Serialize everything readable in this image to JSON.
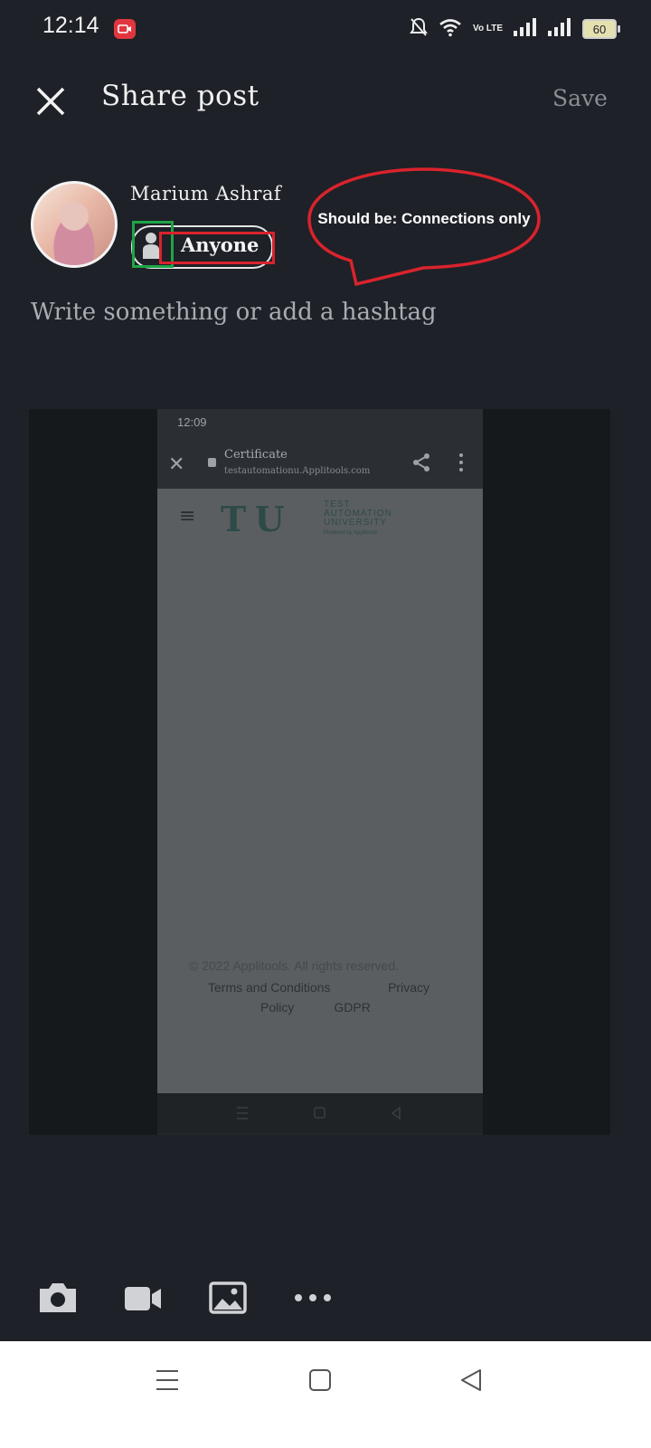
{
  "status_bar": {
    "time": "12:14",
    "volte_label": "Vo LTE",
    "battery_level": "60"
  },
  "header": {
    "title": "Share post",
    "save_label": "Save"
  },
  "profile": {
    "name": "Marium Ashraf",
    "audience_label": "Anyone"
  },
  "annotation": {
    "callout_text": "Should be: Connections only",
    "colors": {
      "red": "#d9232d",
      "green": "#1ea548"
    }
  },
  "composer": {
    "placeholder": "Write something or add a hashtag"
  },
  "embedded_screenshot": {
    "time": "12:09",
    "page_title": "Certificate",
    "url": "testautomationu.Applitools.com",
    "logo_mark": "T U",
    "logo_lines": [
      "TEST",
      "AUTOMATION",
      "UNIVERSITY"
    ],
    "logo_powered": "Powered by Applitools",
    "footer_copy": "© 2022 Applitools. All rights reserved.",
    "footer_links": [
      "Terms and Conditions",
      "Privacy",
      "Policy",
      "GDPR"
    ]
  },
  "toolbar": {
    "icons": [
      "camera-icon",
      "video-icon",
      "image-icon",
      "more-icon"
    ]
  },
  "system_nav": {
    "icons": [
      "menu-icon",
      "home-icon",
      "back-icon"
    ]
  },
  "colors": {
    "background": "#1e2127",
    "text_primary": "#f0f0f0",
    "text_muted": "#8b8e94"
  }
}
